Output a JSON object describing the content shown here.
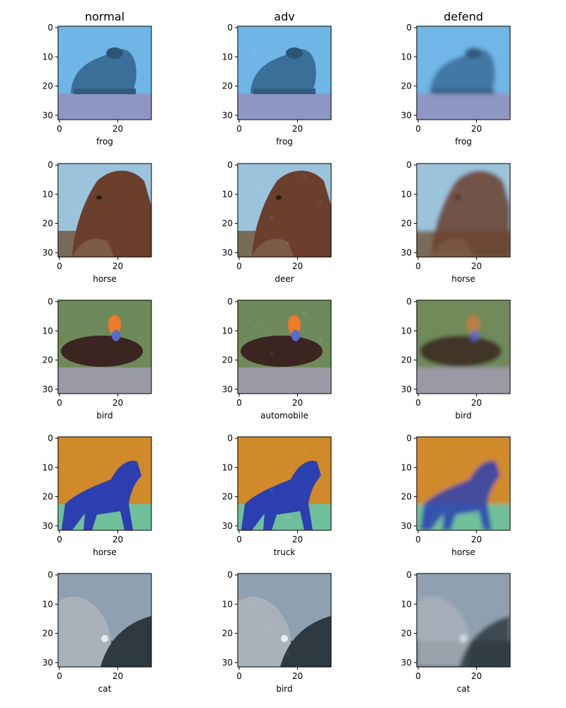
{
  "chart_data": {
    "type": "image_grid",
    "columns": [
      "normal",
      "adv",
      "defend"
    ],
    "axes": {
      "xticks": [
        0,
        20
      ],
      "yticks": [
        0,
        10,
        20,
        30
      ],
      "xlim": [
        -0.5,
        31.5
      ],
      "ylim": [
        31.5,
        -0.5
      ]
    },
    "rows": [
      {
        "labels": [
          "frog",
          "frog",
          "frog"
        ],
        "scene": {
          "bg": "#6fb6e6",
          "bottom": "#8e96c4",
          "subject": "#3a6f99",
          "subject_shape": "frog"
        }
      },
      {
        "labels": [
          "horse",
          "deer",
          "horse"
        ],
        "scene": {
          "bg": "#9cc3dc",
          "bottom": "#7a6a5a",
          "subject": "#6a3f2c",
          "subject_shape": "horse-head"
        }
      },
      {
        "labels": [
          "bird",
          "automobile",
          "bird"
        ],
        "scene": {
          "bg": "#6f8a5a",
          "bottom": "#9a9aa6",
          "subject": "#3a2520",
          "subject_shape": "bird",
          "accent": "#f07a2a"
        }
      },
      {
        "labels": [
          "horse",
          "truck",
          "horse"
        ],
        "scene": {
          "bg": "#d08a2a",
          "bottom": "#6fc09a",
          "subject": "#2c3fb0",
          "subject_shape": "horse"
        }
      },
      {
        "labels": [
          "cat",
          "bird",
          "cat"
        ],
        "scene": {
          "bg": "#8fa0b0",
          "bottom": "#3e4a55",
          "subject": "#a9b2bb",
          "subject_shape": "cat"
        }
      }
    ]
  }
}
